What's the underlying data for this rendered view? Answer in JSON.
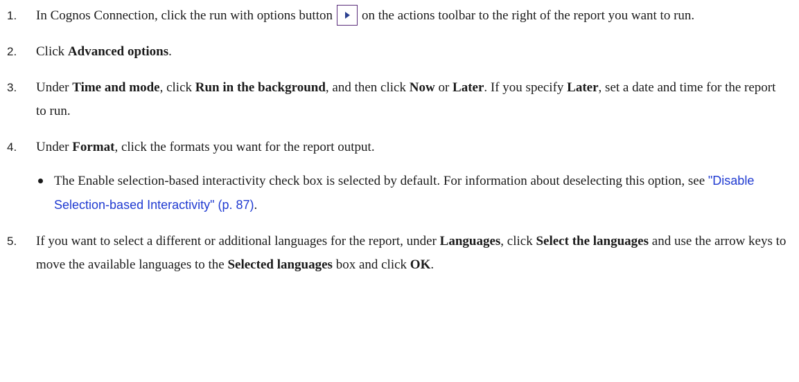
{
  "steps": [
    {
      "num": "1.",
      "t1": "In Cognos Connection, click the run with options button",
      "t2": "on the actions toolbar to the right of the report you want to run.",
      "button_icon": "run-with-options-icon"
    },
    {
      "num": "2.",
      "t1": "Click ",
      "b1": "Advanced options",
      "t2": "."
    },
    {
      "num": "3.",
      "t1": "Under ",
      "b1": "Time and mode",
      "t2": ", click ",
      "b2": "Run in the background",
      "t3": ", and then click ",
      "b3": "Now",
      "t4": " or ",
      "b4": "Later",
      "t5": ". If you specify ",
      "b5": "Later",
      "t6": ", set a date and time for the report to run."
    },
    {
      "num": "4.",
      "t1": "Under ",
      "b1": "Format",
      "t2": ", click the formats you want for the report output.",
      "bullet": {
        "t1": "The Enable selection-based interactivity check box is selected by default. For information about deselecting this option, see ",
        "link": "\"Disable Selection-based Interactivity\" (p. 87)",
        "t2": "."
      }
    },
    {
      "num": "5.",
      "t1": "If you want to select a different or additional languages for the report, under ",
      "b1": "Languages",
      "t2": ", click ",
      "b2": "Select the languages",
      "t3": " and use the arrow keys to move the available languages to the ",
      "b3": "Selected languages",
      "t4": " box and click ",
      "b4": "OK",
      "t5": "."
    }
  ],
  "colors": {
    "link": "#1f3ad1",
    "button_border": "#5a2d7a",
    "button_icon": "#2a3f8f"
  }
}
